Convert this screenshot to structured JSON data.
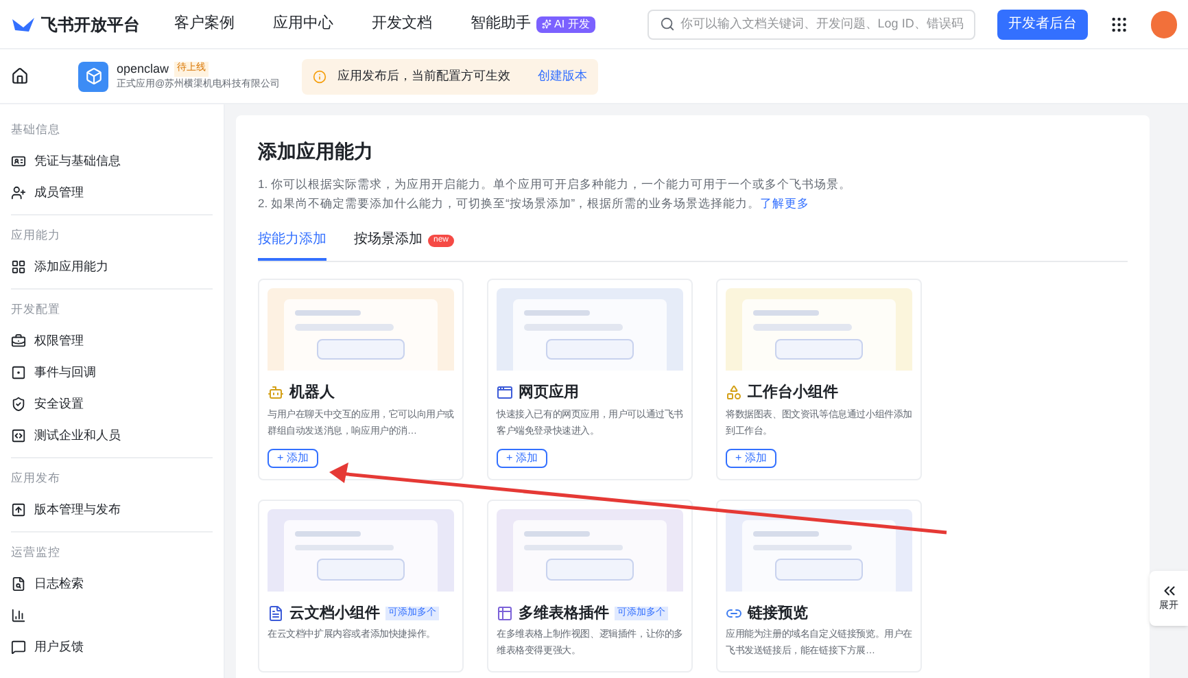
{
  "topbar": {
    "logo_text": "飞书开放平台",
    "nav": [
      {
        "label": "客户案例"
      },
      {
        "label": "应用中心"
      },
      {
        "label": "开发文档"
      },
      {
        "label": "智能助手",
        "badge": "AI 开发"
      }
    ],
    "search": {
      "placeholder": "你可以输入文档关键词、开发问题、Log ID、错误码"
    },
    "console_button": "开发者后台"
  },
  "app_bar": {
    "name": "openclaw",
    "status": "待上线",
    "subtitle": "正式应用@苏州横渠机电科技有限公司",
    "notice": "应用发布后，当前配置方可生效",
    "notice_link": "创建版本"
  },
  "sidebar": [
    {
      "title": "基础信息",
      "items": [
        {
          "label": "凭证与基础信息"
        },
        {
          "label": "成员管理"
        }
      ]
    },
    {
      "title": "应用能力",
      "items": [
        {
          "label": "添加应用能力"
        }
      ]
    },
    {
      "title": "开发配置",
      "items": [
        {
          "label": "权限管理"
        },
        {
          "label": "事件与回调"
        },
        {
          "label": "安全设置"
        },
        {
          "label": "测试企业和人员"
        }
      ]
    },
    {
      "title": "应用发布",
      "items": [
        {
          "label": "版本管理与发布"
        }
      ]
    },
    {
      "title": "运营监控",
      "items": [
        {
          "kind": "labeled",
          "label": "日志检索"
        },
        {
          "kind": "icon_only"
        },
        {
          "kind": "labeled",
          "label": "用户反馈"
        }
      ]
    }
  ],
  "main": {
    "title": "添加应用能力",
    "notes": [
      "1. 你可以根据实际需求，为应用开启能力。单个应用可开启多种能力，一个能力可用于一个或多个飞书场景。",
      "2. 如果尚不确定需要添加什么能力，可切换至“按场景添加”，根据所需的业务场景选择能力。"
    ],
    "notes_link": "了解更多",
    "tabs": [
      {
        "label": "按能力添加",
        "selected": true
      },
      {
        "label": "按场景添加",
        "selected": false,
        "badge": "new"
      }
    ],
    "cards": [
      {
        "title": "机器人",
        "desc": "与用户在聊天中交互的应用，它可以向用户或群组自动发送消息，响应用户的消…",
        "add_label": "+ 添加"
      },
      {
        "title": "网页应用",
        "desc": "快速接入已有的网页应用，用户可以通过飞书客户端免登录快速进入。",
        "add_label": "+ 添加"
      },
      {
        "title": "工作台小组件",
        "desc": "将数据图表、图文资讯等信息通过小组件添加到工作台。",
        "add_label": "+ 添加"
      },
      {
        "title": "云文档小组件",
        "badge": "可添加多个",
        "desc": "在云文档中扩展内容或者添加快捷操作。"
      },
      {
        "title": "多维表格插件",
        "badge": "可添加多个",
        "desc": "在多维表格上制作视图、逻辑插件，让你的多维表格变得更强大。"
      },
      {
        "title": "链接预览",
        "desc": "应用能为注册的域名自定义链接预览。用户在飞书发送链接后，能在链接下方展…"
      }
    ]
  },
  "expand_label": "展开"
}
